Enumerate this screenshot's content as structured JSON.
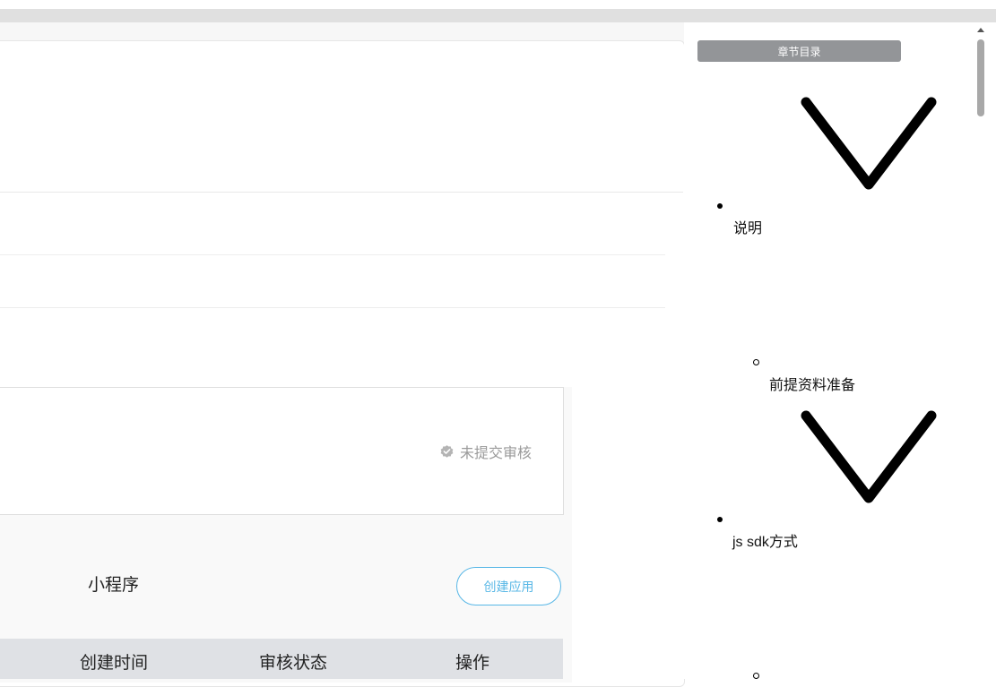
{
  "review": {
    "status_text": "未提交审核",
    "icon": "verified-badge-icon"
  },
  "apps": {
    "tab_label": "小程序",
    "create_button": "创建应用",
    "columns": [
      "创建时间",
      "审核状态",
      "操作"
    ]
  },
  "toc": {
    "header": "章节目录",
    "items": [
      {
        "label": "说明",
        "level": 1
      },
      {
        "label": "前提资料准备",
        "level": 2
      },
      {
        "label": "js sdk方式",
        "level": 1
      },
      {
        "label": "",
        "level": 2
      }
    ]
  },
  "colors": {
    "accent": "#58b7e6",
    "toc_header_bg": "#939598",
    "table_header_bg": "#dfe1e5",
    "status_gray": "#9a9a9a"
  }
}
